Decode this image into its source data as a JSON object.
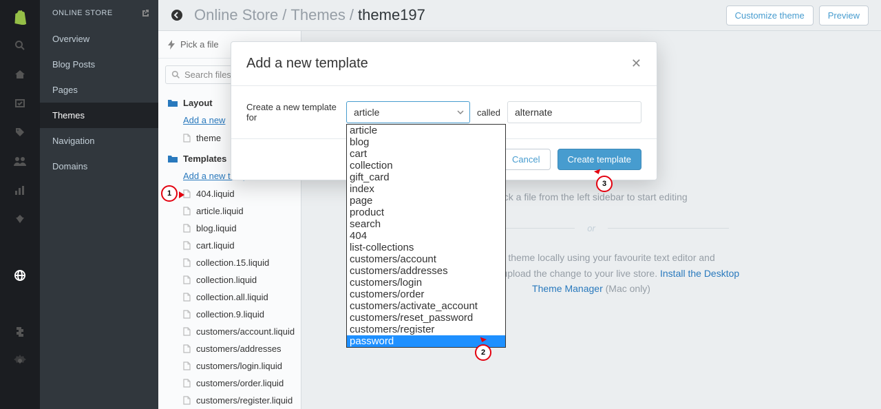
{
  "sidebar": {
    "title": "ONLINE STORE",
    "items": [
      {
        "label": "Overview"
      },
      {
        "label": "Blog Posts"
      },
      {
        "label": "Pages"
      },
      {
        "label": "Themes",
        "active": true
      },
      {
        "label": "Navigation"
      },
      {
        "label": "Domains"
      }
    ]
  },
  "breadcrumb": {
    "parts": [
      "Online Store",
      "Themes"
    ],
    "current": "theme197",
    "sep": "/"
  },
  "topbar": {
    "customize": "Customize theme",
    "preview": "Preview"
  },
  "filetree": {
    "pick": "Pick a file",
    "search_placeholder": "Search files",
    "sections": [
      {
        "label": "Layout",
        "add": "Add a new",
        "files": [
          "theme"
        ]
      },
      {
        "label": "Templates",
        "add": "Add a new template",
        "files": [
          "404.liquid",
          "article.liquid",
          "blog.liquid",
          "cart.liquid",
          "collection.15.liquid",
          "collection.liquid",
          "collection.all.liquid",
          "collection.9.liquid",
          "customers/account.liquid",
          "customers/addresses",
          "customers/login.liquid",
          "customers/order.liquid",
          "customers/register.liquid"
        ]
      }
    ]
  },
  "editor": {
    "pick_hint": "Pick a file from the left sidebar to start editing",
    "or": "or",
    "hint2_a": "Edit your theme locally using your favourite text editor and automatically upload the change to your live store. ",
    "hint2_link": "Install the Desktop Theme Manager",
    "hint2_b": " (Mac only)"
  },
  "modal": {
    "title": "Add a new template",
    "label_for": "Create a new template for",
    "called": "called",
    "selected": "article",
    "input_value": "alternate",
    "options": [
      "article",
      "blog",
      "cart",
      "collection",
      "gift_card",
      "index",
      "page",
      "product",
      "search",
      "404",
      "list-collections",
      "customers/account",
      "customers/addresses",
      "customers/login",
      "customers/order",
      "customers/activate_account",
      "customers/reset_password",
      "customers/register",
      "password"
    ],
    "highlighted": "password",
    "cancel": "Cancel",
    "submit": "Create template"
  },
  "callouts": {
    "1": "1",
    "2": "2",
    "3": "3"
  }
}
